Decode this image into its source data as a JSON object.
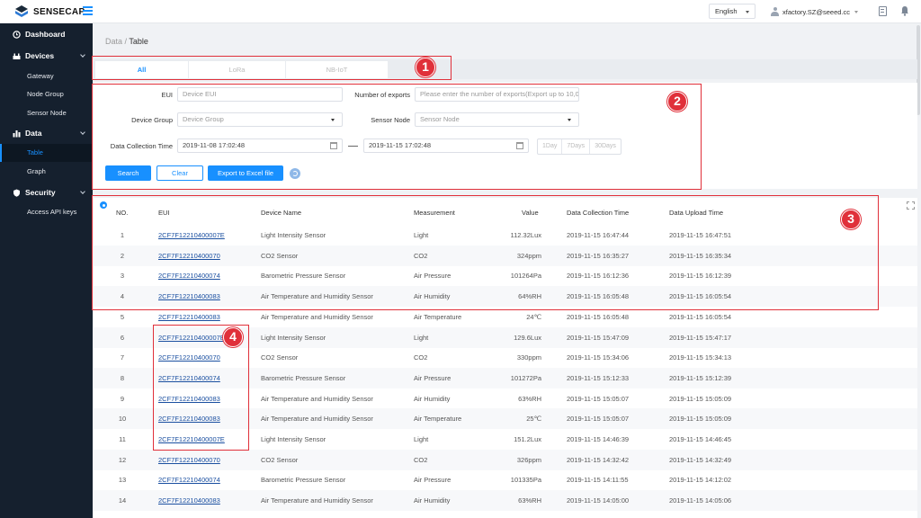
{
  "header": {
    "brand": "SENSECAP",
    "language": "English",
    "user_email": "xfactory.SZ@seeed.cc"
  },
  "sidebar": {
    "groups": [
      {
        "label": "Dashboard",
        "icon": "clock-icon"
      },
      {
        "label": "Devices",
        "icon": "devices-icon",
        "items": [
          "Gateway",
          "Node Group",
          "Sensor Node"
        ]
      },
      {
        "label": "Data",
        "icon": "bar-chart-icon",
        "items": [
          "Table",
          "Graph"
        ]
      },
      {
        "label": "Security",
        "icon": "shield-icon",
        "items": [
          "Access API keys"
        ]
      }
    ],
    "active_item": "Table"
  },
  "breadcrumb": {
    "parent": "Data",
    "separator": " / ",
    "current": "Table"
  },
  "tabs": [
    "All",
    "LoRa",
    "NB-IoT"
  ],
  "active_tab": "All",
  "filters": {
    "eui_label": "EUI",
    "eui_placeholder": "Device EUI",
    "exports_label": "Number of exports",
    "exports_placeholder": "Please enter the number of exports(Export up to 10,0",
    "device_group_label": "Device Group",
    "device_group_value": "Device Group",
    "sensor_node_label": "Sensor Node",
    "sensor_node_value": "Sensor Node",
    "collection_time_label": "Data Collection Time",
    "start_time": "2019-11-08 17:02:48",
    "end_time": "2019-11-15 17:02:48",
    "quick_ranges": [
      "1Day",
      "7Days",
      "30Days"
    ],
    "search_label": "Search",
    "clear_label": "Clear",
    "export_label": "Export to Excel file"
  },
  "table": {
    "columns": [
      "NO.",
      "EUI",
      "Device Name",
      "Measurement",
      "Value",
      "Data Collection Time",
      "Data Upload Time"
    ],
    "rows": [
      [
        "1",
        "2CF7F12210400007E",
        "Light Intensity Sensor",
        "Light",
        "112.32Lux",
        "2019-11-15 16:47:44",
        "2019-11-15 16:47:51"
      ],
      [
        "2",
        "2CF7F12210400070",
        "CO2 Sensor",
        "CO2",
        "324ppm",
        "2019-11-15 16:35:27",
        "2019-11-15 16:35:34"
      ],
      [
        "3",
        "2CF7F12210400074",
        "Barometric Pressure Sensor",
        "Air Pressure",
        "101264Pa",
        "2019-11-15 16:12:36",
        "2019-11-15 16:12:39"
      ],
      [
        "4",
        "2CF7F12210400083",
        "Air Temperature and Humidity Sensor",
        "Air Humidity",
        "64%RH",
        "2019-11-15 16:05:48",
        "2019-11-15 16:05:54"
      ],
      [
        "5",
        "2CF7F12210400083",
        "Air Temperature and Humidity Sensor",
        "Air Temperature",
        "24℃",
        "2019-11-15 16:05:48",
        "2019-11-15 16:05:54"
      ],
      [
        "6",
        "2CF7F12210400007E",
        "Light Intensity Sensor",
        "Light",
        "129.6Lux",
        "2019-11-15 15:47:09",
        "2019-11-15 15:47:17"
      ],
      [
        "7",
        "2CF7F12210400070",
        "CO2 Sensor",
        "CO2",
        "330ppm",
        "2019-11-15 15:34:06",
        "2019-11-15 15:34:13"
      ],
      [
        "8",
        "2CF7F12210400074",
        "Barometric Pressure Sensor",
        "Air Pressure",
        "101272Pa",
        "2019-11-15 15:12:33",
        "2019-11-15 15:12:39"
      ],
      [
        "9",
        "2CF7F12210400083",
        "Air Temperature and Humidity Sensor",
        "Air Humidity",
        "63%RH",
        "2019-11-15 15:05:07",
        "2019-11-15 15:05:09"
      ],
      [
        "10",
        "2CF7F12210400083",
        "Air Temperature and Humidity Sensor",
        "Air Temperature",
        "25℃",
        "2019-11-15 15:05:07",
        "2019-11-15 15:05:09"
      ],
      [
        "11",
        "2CF7F12210400007E",
        "Light Intensity Sensor",
        "Light",
        "151.2Lux",
        "2019-11-15 14:46:39",
        "2019-11-15 14:46:45"
      ],
      [
        "12",
        "2CF7F12210400070",
        "CO2 Sensor",
        "CO2",
        "326ppm",
        "2019-11-15 14:32:42",
        "2019-11-15 14:32:49"
      ],
      [
        "13",
        "2CF7F12210400074",
        "Barometric Pressure Sensor",
        "Air Pressure",
        "101335Pa",
        "2019-11-15 14:11:55",
        "2019-11-15 14:12:02"
      ],
      [
        "14",
        "2CF7F12210400083",
        "Air Temperature and Humidity Sensor",
        "Air Humidity",
        "63%RH",
        "2019-11-15 14:05:00",
        "2019-11-15 14:05:06"
      ]
    ]
  },
  "callouts": [
    "1",
    "2",
    "3",
    "4"
  ],
  "colors": {
    "accent": "#1890ff",
    "sidebar": "#15202e",
    "callout": "#e0303a"
  }
}
